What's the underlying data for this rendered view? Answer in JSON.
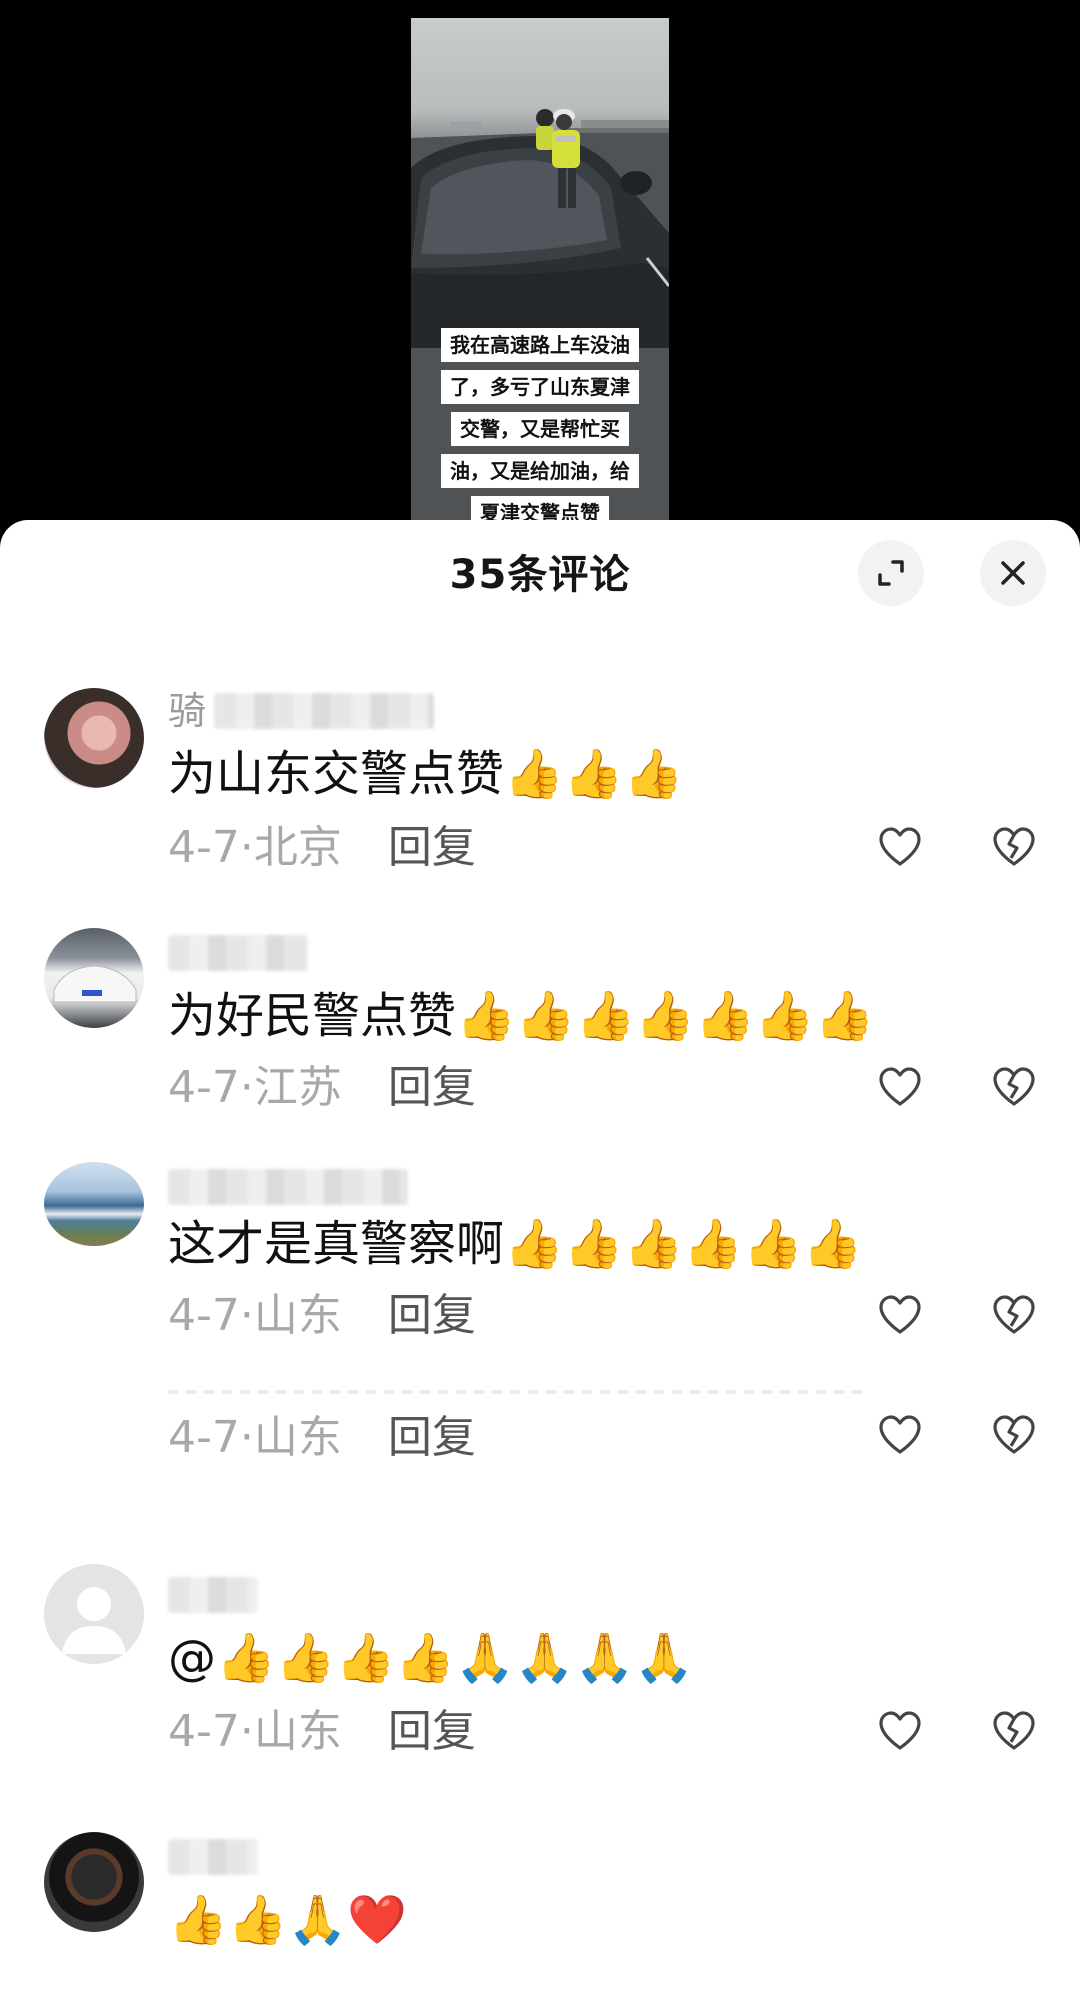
{
  "video": {
    "caption_lines": [
      "我在高速路上车没油",
      "了，多亏了山东夏津",
      "交警，又是帮忙买",
      "油，又是给加油，给",
      "夏津交警点赞"
    ]
  },
  "sheet": {
    "title": "35条评论"
  },
  "comments": [
    {
      "username": "骑",
      "text": "为山东交警点赞👍👍👍",
      "date_loc": "4-7·北京",
      "reply": "回复"
    },
    {
      "username": "",
      "text": "为好民警点赞👍👍👍👍👍👍👍",
      "date_loc": "4-7·江苏",
      "reply": "回复"
    },
    {
      "username": "",
      "text": "这才是真警察啊👍👍👍👍👍👍",
      "date_loc": "4-7·山东",
      "reply": "回复"
    },
    {
      "date_loc": "4-7·山东",
      "reply": "回复"
    },
    {
      "username": "",
      "text": "@👍👍👍👍🙏🙏🙏🙏",
      "date_loc": "4-7·山东",
      "reply": "回复"
    },
    {
      "username": "",
      "text": "👍👍🙏❤️"
    }
  ],
  "icons": {
    "expand": "expand-icon",
    "close": "close-icon",
    "like": "heart-icon",
    "dislike": "broken-heart-icon",
    "default_avatar": "person-icon"
  },
  "colors": {
    "sheet_bg": "#ffffff",
    "meta_gray": "#a8a8a8",
    "reply_gray": "#555555",
    "title": "#161616"
  }
}
